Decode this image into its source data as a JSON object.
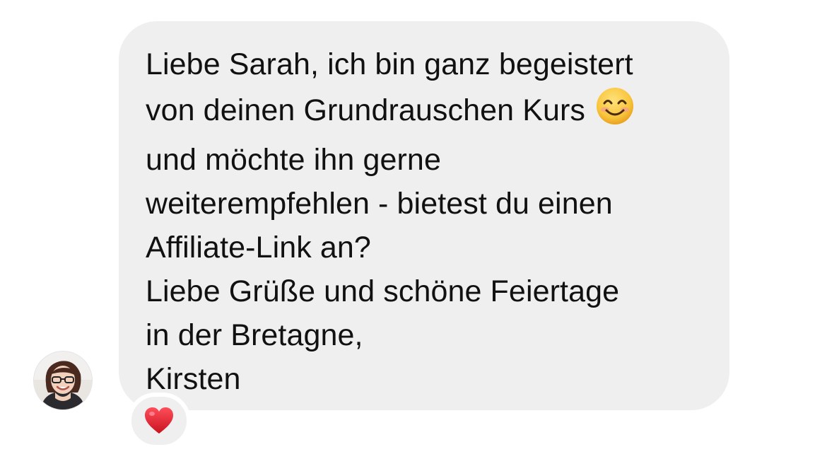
{
  "message": {
    "lines": [
      "Liebe Sarah, ich bin ganz begeistert",
      "von deinen Grundrauschen Kurs",
      "und möchte ihn gerne",
      "weiterempfehlen - bietest du einen",
      "Affiliate-Link an?",
      "Liebe Grüße und schöne Feiertage",
      "in der Bretagne,",
      "Kirsten"
    ],
    "inline_emoji": "smiling-face-emoji"
  },
  "sender": {
    "avatar_icon": "user-photo-avatar"
  },
  "reaction": {
    "icon": "red-heart-icon"
  },
  "colors": {
    "bubble": "#efefef",
    "text": "#111111",
    "heart": "#e0242b",
    "emoji": "#f7c23a"
  }
}
